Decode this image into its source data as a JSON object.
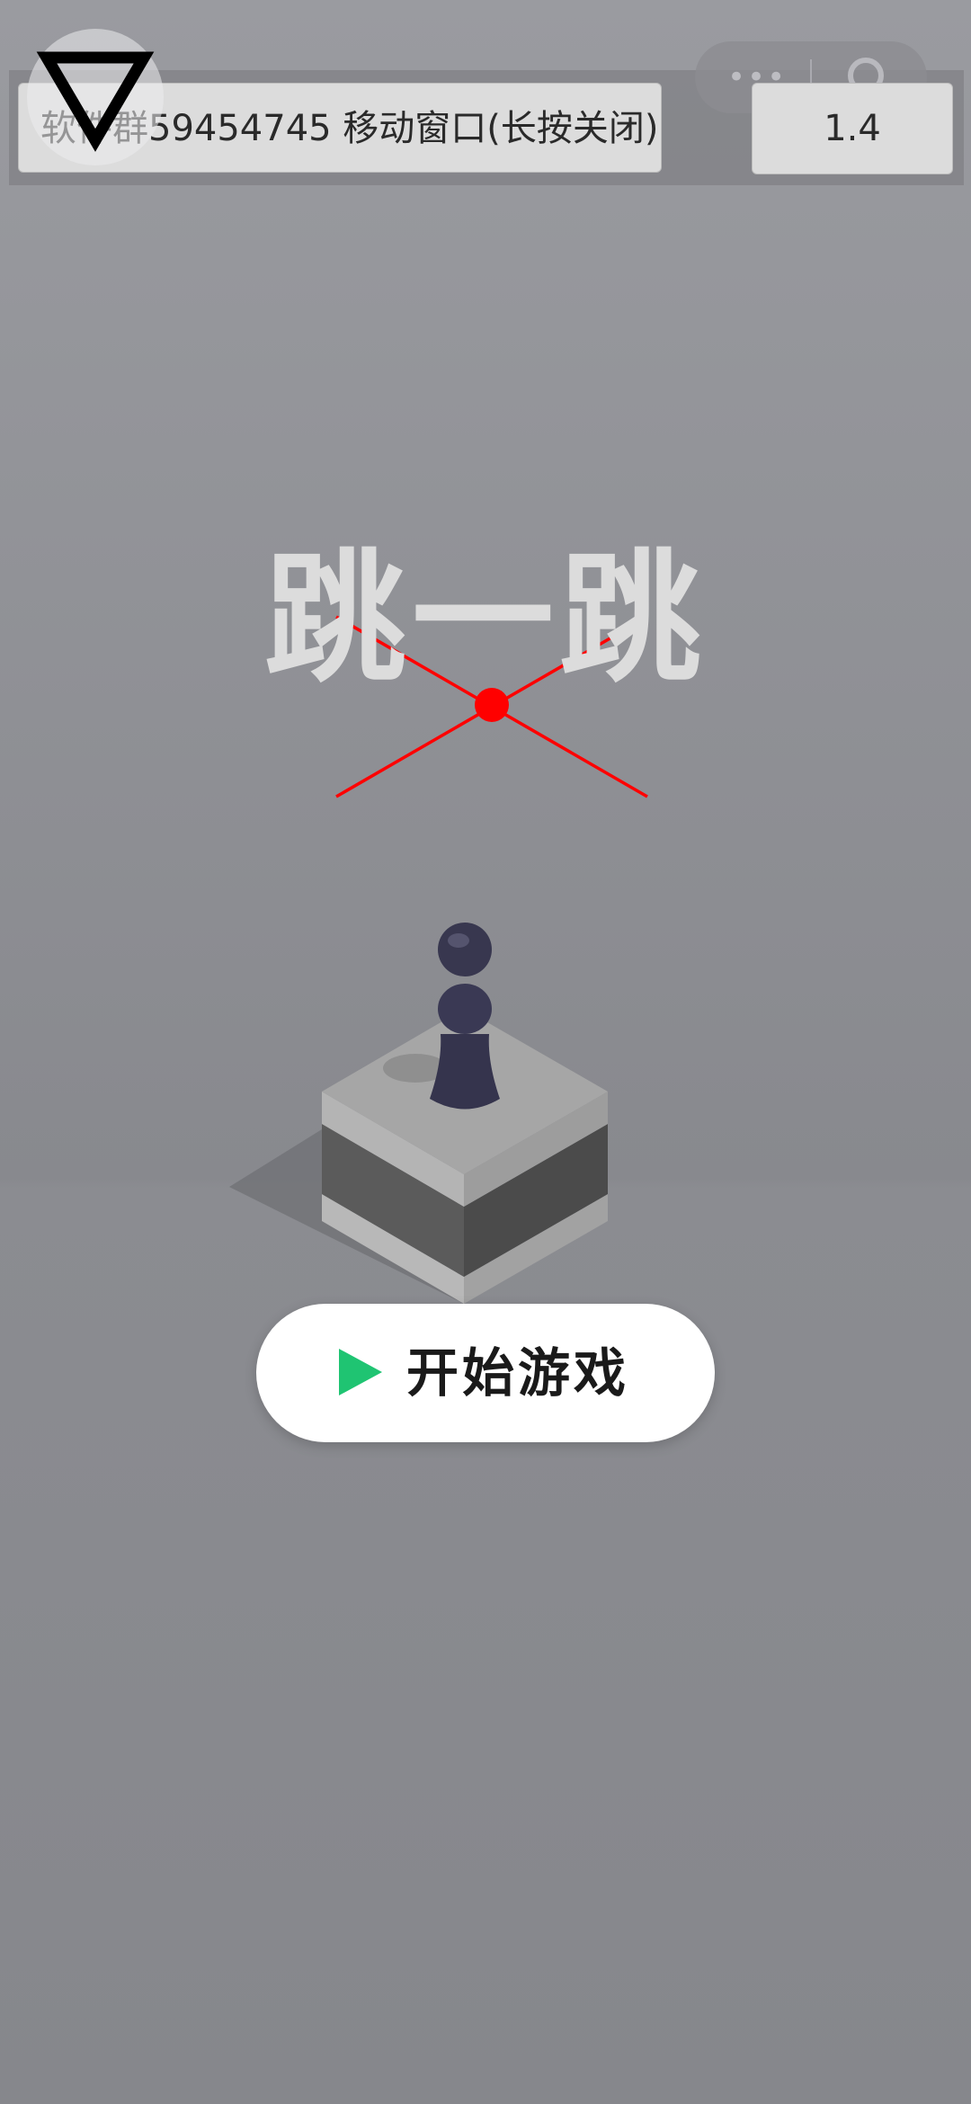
{
  "overlay": {
    "info_text": "软件群59454745  移动窗口(长按关闭)",
    "version": "1.4"
  },
  "game": {
    "title": "跳一跳",
    "start_label": "开始游戏"
  },
  "icons": {
    "float_button": "triangle-down-icon",
    "capsule_more": "more-dots-icon",
    "capsule_close": "close-circle-icon",
    "start_play": "play-icon"
  },
  "colors": {
    "crosshair": "#ff0000",
    "play_icon": "#1fc472",
    "background": "#8d8e93"
  }
}
